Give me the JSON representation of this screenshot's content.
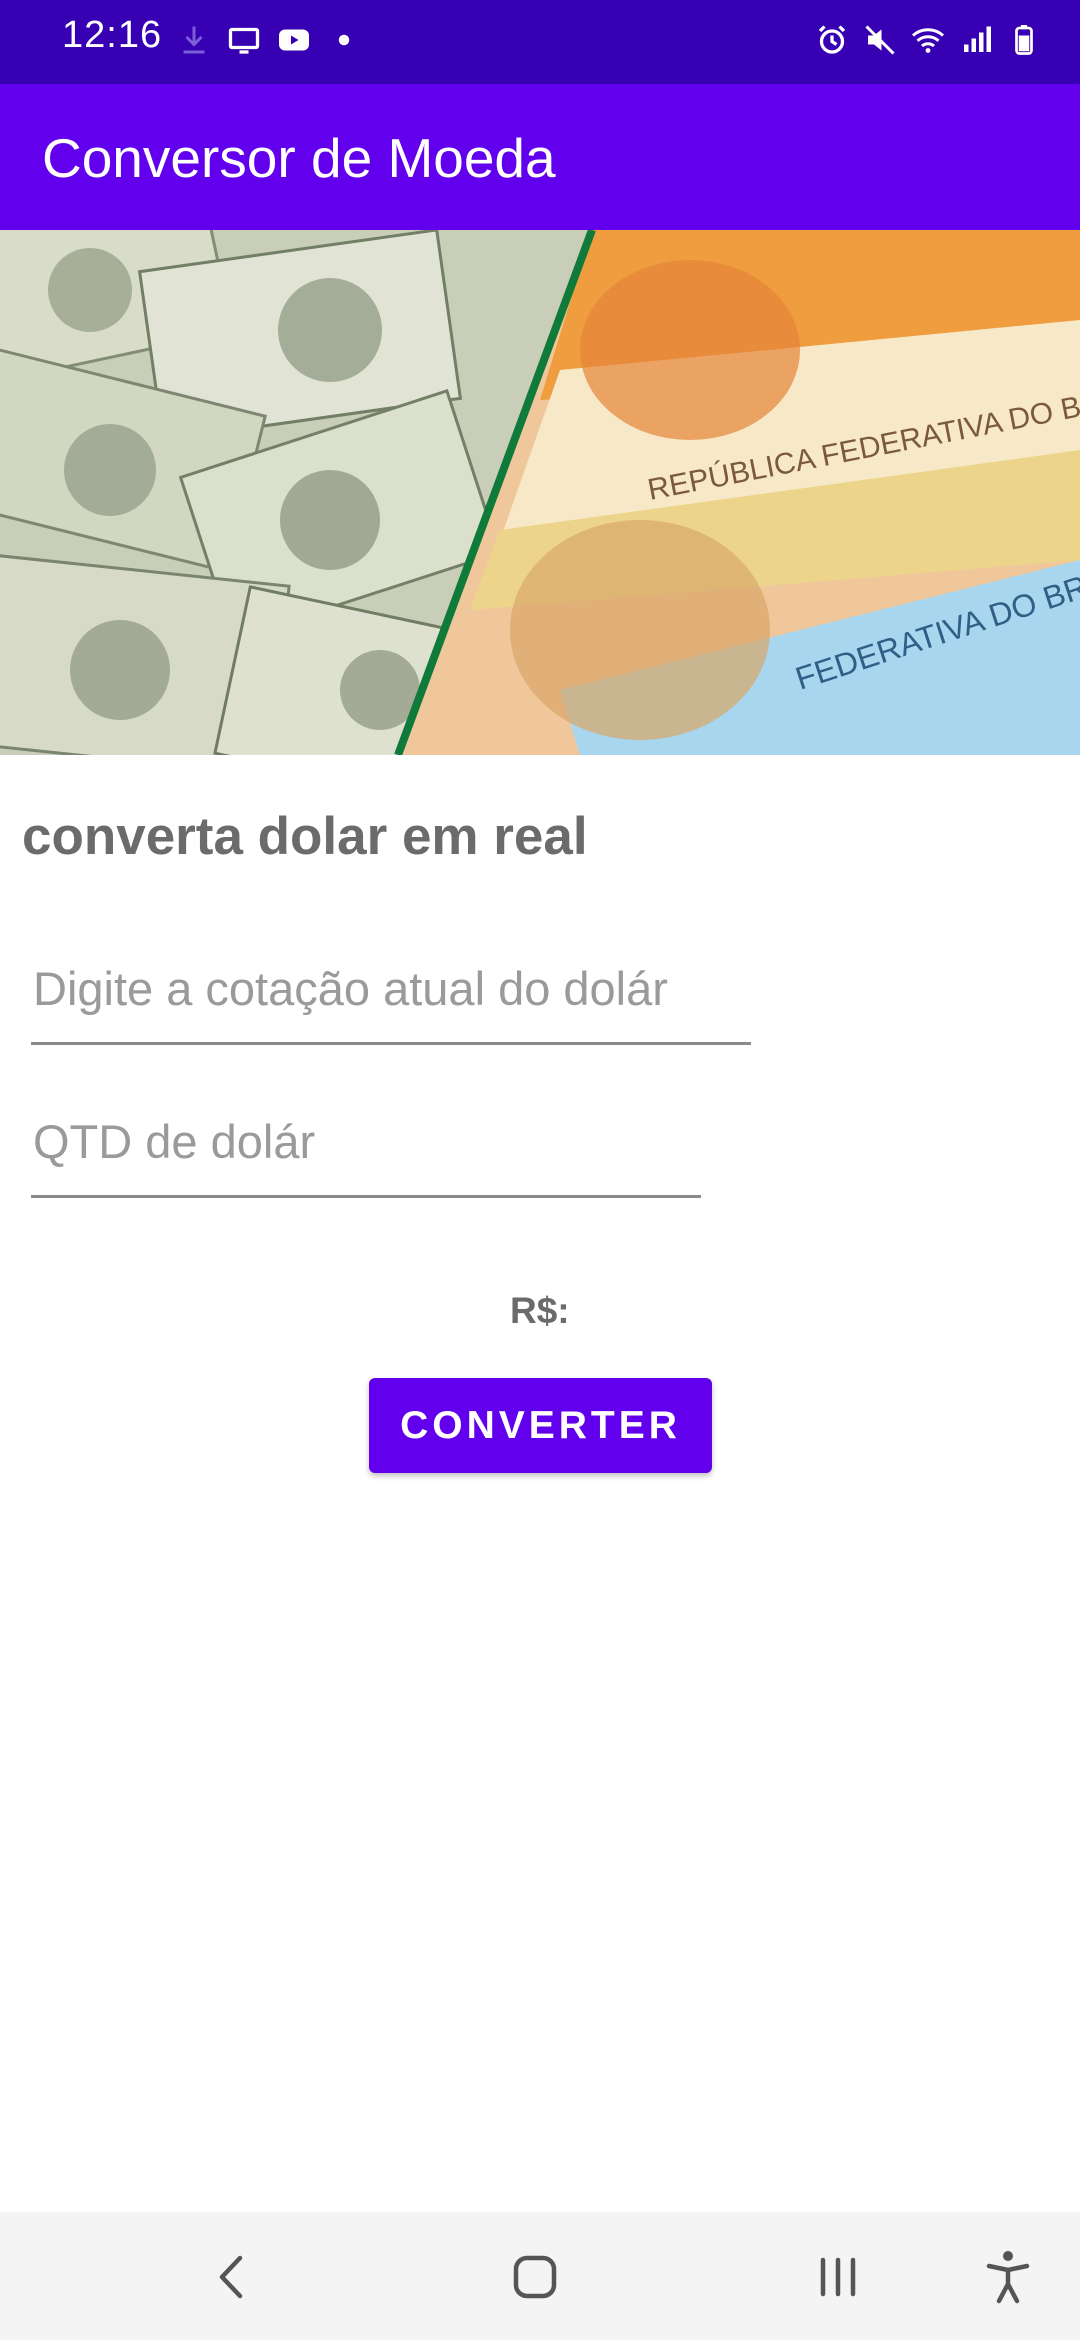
{
  "status_bar": {
    "time": "12:16",
    "left_icons": [
      "download-icon",
      "cast-icon",
      "youtube-icon",
      "dot-icon"
    ],
    "right_icons": [
      "alarm-icon",
      "mute-icon",
      "wifi-icon",
      "signal-icon",
      "battery-icon"
    ]
  },
  "app_bar": {
    "title": "Conversor de Moeda",
    "color": "#6200ee"
  },
  "banner": {
    "left_caption": "",
    "right_text_1": "REPÚBLICA FEDERATIVA DO BRASIL",
    "right_text_2": "FEDERATIVA DO BRASIL"
  },
  "main": {
    "heading": "converta dolar em real",
    "rate_input": {
      "value": "",
      "placeholder": "Digite a cotação atual do dolár"
    },
    "qty_input": {
      "value": "",
      "placeholder": "QTD de dolár"
    },
    "result_label": "R$:",
    "convert_button": "CONVERTER"
  },
  "nav_bar": {
    "buttons": [
      "back-icon",
      "home-icon",
      "recents-icon",
      "accessibility-icon"
    ]
  },
  "colors": {
    "status_bar": "#3700b3",
    "primary": "#6200ee",
    "text_secondary": "#6b6b6b"
  }
}
